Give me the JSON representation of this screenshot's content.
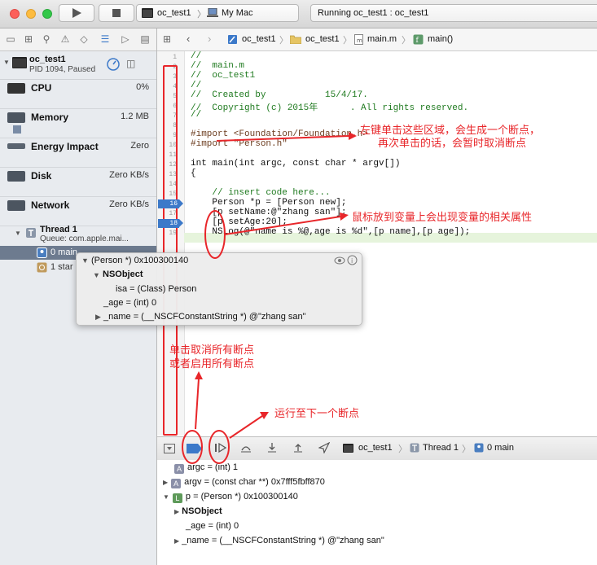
{
  "toolbar": {
    "scheme_target": "oc_test1",
    "scheme_destination": "My Mac",
    "status_text": "Running oc_test1 : oc_test1"
  },
  "navigator": {
    "process_name": "oc_test1",
    "process_info": "PID 1094, Paused",
    "gauges": [
      {
        "label": "CPU",
        "value": "0%"
      },
      {
        "label": "Memory",
        "value": "1.2 MB"
      },
      {
        "label": "Energy Impact",
        "value": "Zero"
      },
      {
        "label": "Disk",
        "value": "Zero KB/s"
      },
      {
        "label": "Network",
        "value": "Zero KB/s"
      }
    ],
    "thread_name": "Thread 1",
    "thread_queue": "Queue: com.apple.mai...",
    "frames": [
      {
        "label": "0 main"
      },
      {
        "label": "1 star"
      }
    ]
  },
  "jumpbar": {
    "items": [
      "oc_test1",
      "oc_test1",
      "main.m",
      "main()"
    ]
  },
  "editor": {
    "lines": [
      {
        "n": "1",
        "text": "//",
        "cls": "cm"
      },
      {
        "n": "2",
        "text": "//  main.m",
        "cls": "cm"
      },
      {
        "n": "3",
        "text": "//  oc_test1",
        "cls": "cm"
      },
      {
        "n": "4",
        "text": "//",
        "cls": "cm"
      },
      {
        "n": "5",
        "text": "//  Created by           15/4/17.",
        "cls": "cm"
      },
      {
        "n": "6",
        "text": "//  Copyright (c) 2015年      . All rights reserved.",
        "cls": "cm"
      },
      {
        "n": "7",
        "text": "//",
        "cls": "cm"
      },
      {
        "n": "8",
        "text": "",
        "cls": "pl"
      },
      {
        "n": "9",
        "text": "#import <Foundation/Foundation.h>",
        "cls": "pp"
      },
      {
        "n": "10",
        "text": "#import \"Person.h\"",
        "cls": "pp"
      },
      {
        "n": "11",
        "text": "",
        "cls": "pl"
      },
      {
        "n": "12",
        "text": "int main(int argc, const char * argv[])",
        "cls": "pl"
      },
      {
        "n": "13",
        "text": "{",
        "cls": "pl"
      },
      {
        "n": "14",
        "text": "",
        "cls": "pl"
      },
      {
        "n": "15",
        "text": "    // insert code here...",
        "cls": "cm"
      },
      {
        "n": "16",
        "text": "    Person *p = [Person new];",
        "cls": "pl"
      },
      {
        "n": "17",
        "text": "    [p setName:@\"zhang san\"];",
        "cls": "pl"
      },
      {
        "n": "18",
        "text": "    [p setAge:20];",
        "cls": "pl"
      },
      {
        "n": "19",
        "text": "    NSLog(@\"name is %@,age is %d\",[p name],[p age]);",
        "cls": "pl"
      }
    ],
    "breakpoints": [
      "16",
      "18"
    ]
  },
  "popover": {
    "header": "(Person *) 0x100300140",
    "ns_object": "NSObject",
    "isa": "isa = (Class) Person",
    "age": "_age = (int) 0",
    "name": "_name = (__NSCFConstantString *) @\"zhang san\""
  },
  "debugbar": {
    "crumbs": [
      "oc_test1",
      "Thread 1",
      "0 main"
    ]
  },
  "variables": [
    {
      "tag": "A",
      "tag_color": "#8a8fa8",
      "text": "argc = (int) 1"
    },
    {
      "tag": "A",
      "tag_color": "#8a8fa8",
      "text": "argv = (const char **) 0x7fff5fbff870"
    },
    {
      "tag": "L",
      "tag_color": "#5e9a5a",
      "text": "p = (Person *) 0x100300140"
    },
    {
      "tag": "",
      "tag_color": "",
      "text": "NSObject"
    },
    {
      "tag": "",
      "tag_color": "",
      "text": "_age = (int) 0"
    },
    {
      "tag": "",
      "tag_color": "",
      "text": "_name = (__NSCFConstantString *) @\"zhang san\""
    }
  ],
  "annotations": {
    "gutter_line1": "左键单击这些区域，会生成一个断点，",
    "gutter_line2": "再次单击的话，会暂时取消断点",
    "hover": "鼠标放到变量上会出现变量的相关属性",
    "toggle_line1": "单击取消所有断点",
    "toggle_line2": "或者启用所有断点",
    "continue": "运行至下一个断点"
  },
  "colors": {
    "annotation": "#e8262a",
    "breakpoint": "#3c79c9",
    "current_line": "#e6f4dc"
  }
}
